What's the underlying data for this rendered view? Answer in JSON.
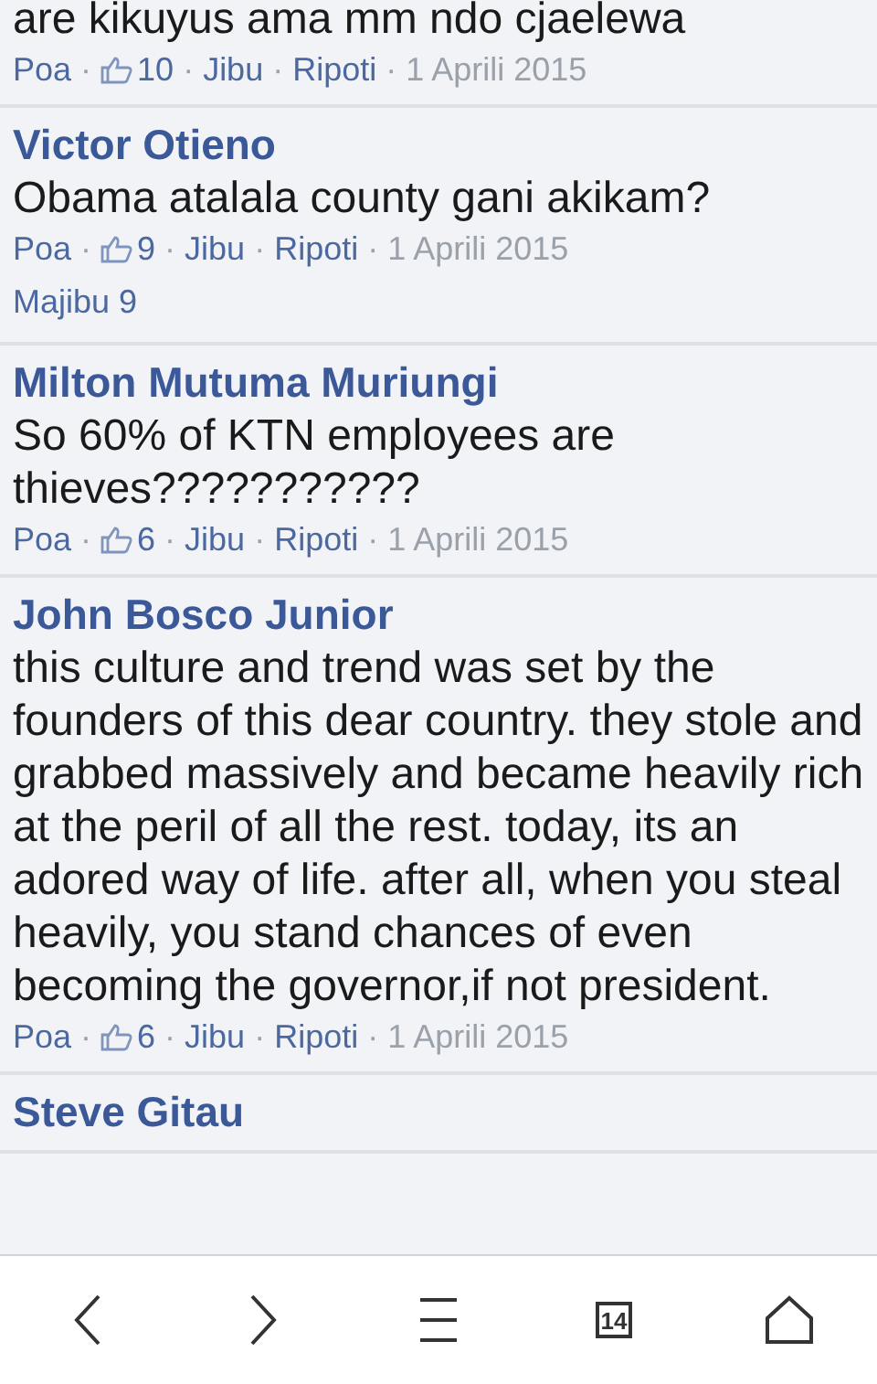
{
  "comments": [
    {
      "text": "are kikuyus ama mm ndo cjaelewa",
      "like_label": "Poa",
      "separator": "·",
      "likes": "10",
      "reply_label": "Jibu",
      "report_label": "Ripoti",
      "date": "1 Aprili 2015"
    },
    {
      "author": "Victor Otieno",
      "text": "Obama atalala county gani akikam?",
      "like_label": "Poa",
      "separator": "·",
      "likes": "9",
      "reply_label": "Jibu",
      "report_label": "Ripoti",
      "date": "1 Aprili 2015",
      "replies": "Majibu 9"
    },
    {
      "author": "Milton Mutuma Muriungi",
      "text": "So 60% of KTN employees are thieves???????????",
      "like_label": "Poa",
      "separator": "·",
      "likes": "6",
      "reply_label": "Jibu",
      "report_label": "Ripoti",
      "date": "1 Aprili 2015"
    },
    {
      "author": "John Bosco Junior",
      "text": "this culture and trend was set by the founders of this dear country. they stole and grabbed massively and became heavily rich at the peril of all the rest. today, its an adored way of life. after all, when you steal heavily, you stand chances of even becoming the governor,if not president.",
      "like_label": "Poa",
      "separator": "·",
      "likes": "6",
      "reply_label": "Jibu",
      "report_label": "Ripoti",
      "date": "1 Aprili 2015"
    },
    {
      "author": "Steve Gitau"
    }
  ],
  "toolbar": {
    "tab_count": "14"
  }
}
